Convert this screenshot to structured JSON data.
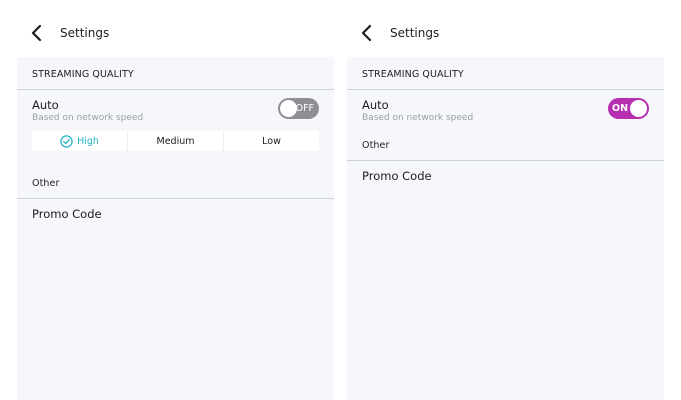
{
  "left": {
    "header": {
      "title": "Settings"
    },
    "streaming_section_label": "STREAMING QUALITY",
    "auto": {
      "title": "Auto",
      "subtitle": "Based on network speed",
      "toggle_state": "OFF"
    },
    "quality_options": [
      "High",
      "Medium",
      "Low"
    ],
    "quality_selected": "High",
    "other_section_label": "Other",
    "promo_code_label": "Promo Code"
  },
  "right": {
    "header": {
      "title": "Settings"
    },
    "streaming_section_label": "STREAMING QUALITY",
    "auto": {
      "title": "Auto",
      "subtitle": "Based on network speed",
      "toggle_state": "ON"
    },
    "other_section_label": "Other",
    "promo_code_label": "Promo Code"
  },
  "colors": {
    "toggle_on": "#b72fb1",
    "toggle_off": "#8d8f95",
    "selected_quality": "#2ab3c8",
    "panel_background": "#f5f7fb"
  }
}
